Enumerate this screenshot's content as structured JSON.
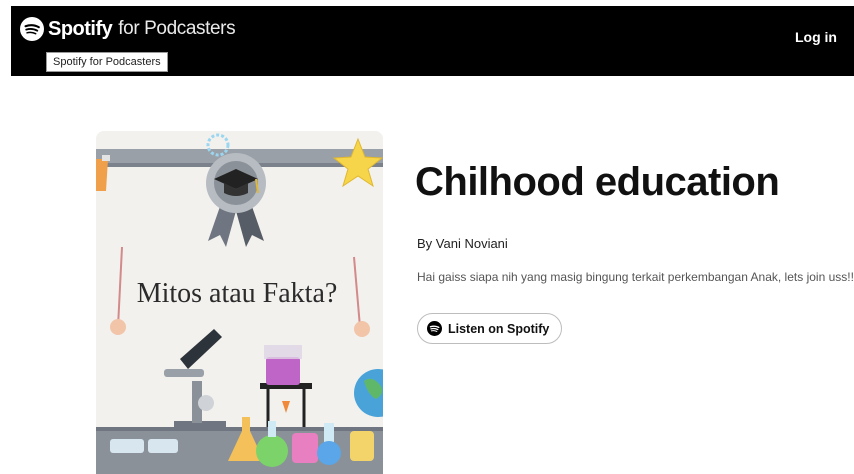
{
  "header": {
    "brand_main": "Spotify",
    "brand_suffix": "for Podcasters",
    "tooltip": "Spotify for Podcasters",
    "login_label": "Log in",
    "logo_icon": "spotify-logo-icon"
  },
  "show": {
    "cover_text": "Mitos atau Fakta?",
    "title": "Chilhood education",
    "byline": "By Vani Noviani",
    "description": "Hai gaiss siapa nih yang masig bingung terkait perkembangan Anak, lets join uss!!",
    "listen_label": "Listen on Spotify",
    "listen_icon": "spotify-icon"
  },
  "colors": {
    "header_bg": "#000000",
    "accent_star": "#f7d54a",
    "badge_grey": "#6f7681",
    "flask_pink": "#e87fc0",
    "flask_green": "#7bd36a"
  }
}
